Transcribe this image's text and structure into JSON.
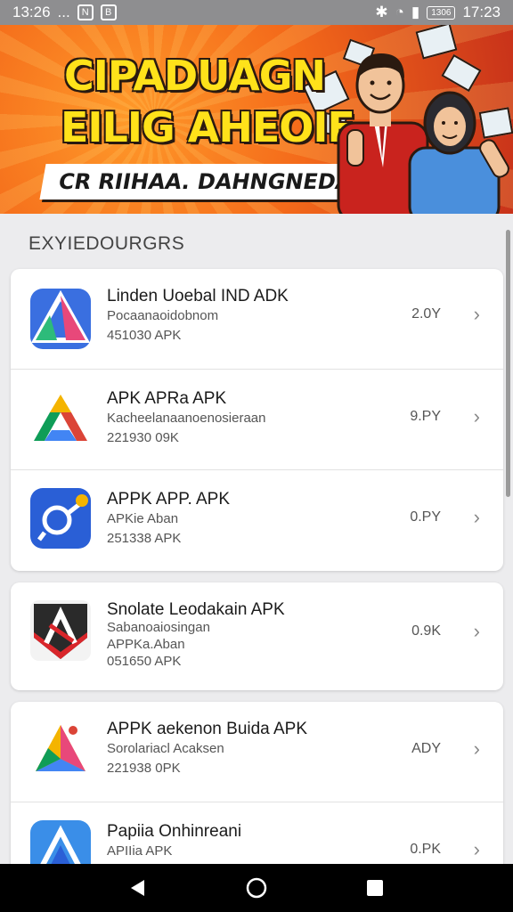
{
  "status_bar": {
    "time": "13:26",
    "left_extra": "...",
    "box1": "N",
    "box2": "B",
    "battery": "1306",
    "clock_right": "17:23"
  },
  "banner": {
    "line1": "CIPADUAGN",
    "line2": "EILIG AHEOIE",
    "sub": "CR RIIHAA. DAHNGNEDA A"
  },
  "section_title": "EXYIEDOURGRS",
  "cards": [
    {
      "rows": [
        {
          "name": "Linden Uoebal IND ADK",
          "line1": "Pocaanaoidobnom",
          "line2": "451030 APK",
          "size": "2.0Y",
          "icon": "triangle-blue-icon"
        },
        {
          "name": "APK APRa APK",
          "line1": "Kacheelanaanoenosieraan",
          "line2": "221930 09K",
          "size": "9.PY",
          "icon": "drive-triangle-icon"
        },
        {
          "name": "APPK APP. APK",
          "line1": "APKie Aban",
          "line2": "251338 APK",
          "size": "0.PY",
          "icon": "link-icon"
        }
      ]
    },
    {
      "rows": [
        {
          "name": "Snolate Leodakain APK",
          "line1": "Sabanoaiosingan",
          "line2": "APPKa.Aban",
          "line3": "051650 APK",
          "size": "0.9K",
          "icon": "shield-a-icon"
        }
      ]
    },
    {
      "rows": [
        {
          "name": "APPK aekenon Buida APK",
          "line1": "Sorolariacl Acaksen",
          "line2": "221938 0PK",
          "size": "ADY",
          "icon": "color-triangle-icon"
        },
        {
          "name": "Papiia Onhinreani",
          "line1": "APIIia APK",
          "line2": "",
          "size": "0.PK",
          "icon": "blue-a-icon"
        }
      ]
    }
  ],
  "nav": {
    "back": "back-icon",
    "home": "home-icon",
    "recents": "recents-icon"
  }
}
